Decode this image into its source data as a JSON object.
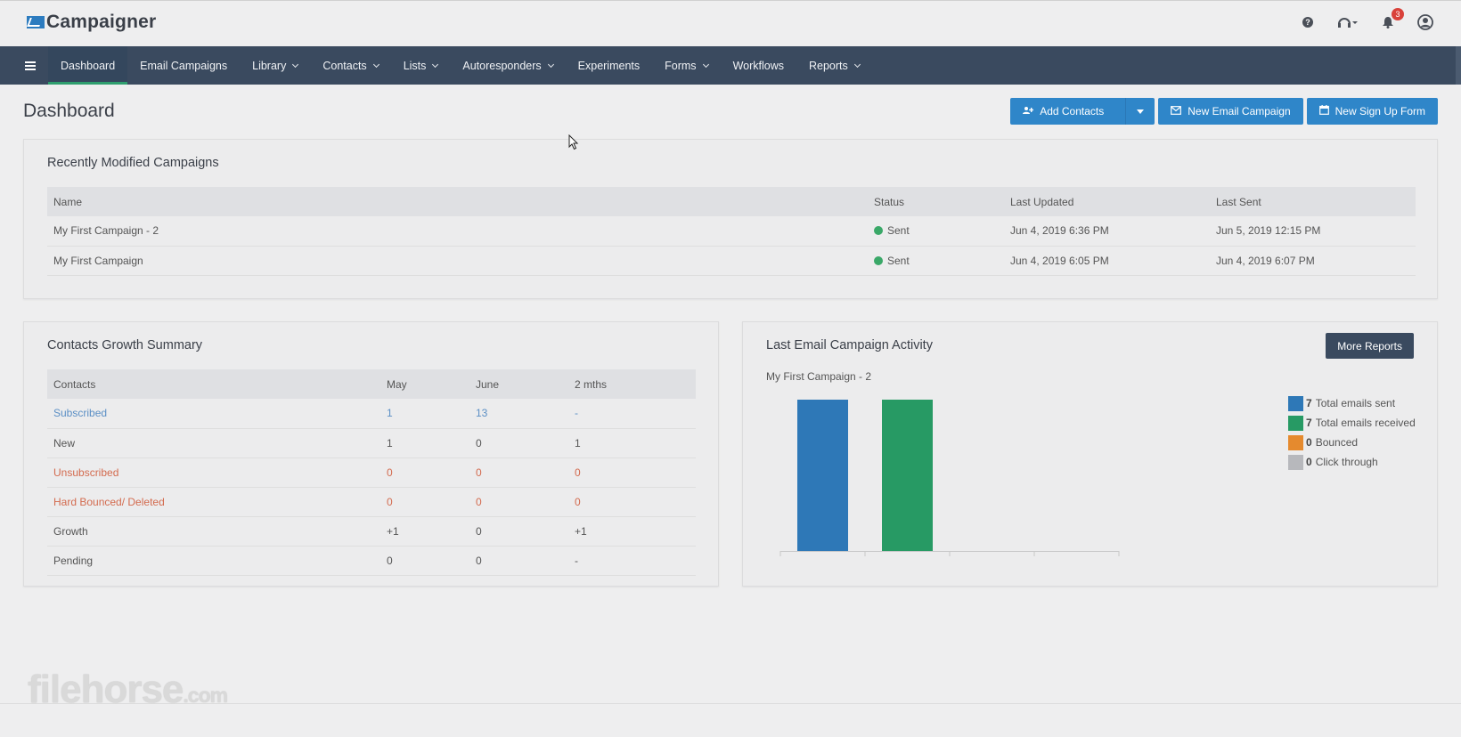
{
  "app": {
    "name": "Campaigner",
    "notification_count": "3"
  },
  "icons": {
    "help": "help-icon",
    "support": "headset-icon",
    "notifications": "bell-icon",
    "account": "user-circle-icon",
    "menu": "hamburger-icon"
  },
  "nav": {
    "items": [
      {
        "label": "Dashboard",
        "dropdown": false,
        "active": true
      },
      {
        "label": "Email Campaigns",
        "dropdown": false
      },
      {
        "label": "Library",
        "dropdown": true
      },
      {
        "label": "Contacts",
        "dropdown": true
      },
      {
        "label": "Lists",
        "dropdown": true
      },
      {
        "label": "Autoresponders",
        "dropdown": true
      },
      {
        "label": "Experiments",
        "dropdown": false
      },
      {
        "label": "Forms",
        "dropdown": true
      },
      {
        "label": "Workflows",
        "dropdown": false
      },
      {
        "label": "Reports",
        "dropdown": true
      }
    ]
  },
  "page": {
    "title": "Dashboard"
  },
  "actions": {
    "add_contacts": "Add Contacts",
    "new_email_campaign": "New Email Campaign",
    "new_sign_up_form": "New Sign Up Form"
  },
  "recent": {
    "title": "Recently Modified Campaigns",
    "headers": [
      "Name",
      "Status",
      "Last Updated",
      "Last Sent"
    ],
    "rows": [
      {
        "name": "My First Campaign - 2",
        "status": "Sent",
        "updated": "Jun 4, 2019 6:36 PM",
        "sent": "Jun 5, 2019 12:15 PM"
      },
      {
        "name": "My First Campaign",
        "status": "Sent",
        "updated": "Jun 4, 2019 6:05 PM",
        "sent": "Jun 4, 2019 6:07 PM"
      }
    ]
  },
  "growth": {
    "title": "Contacts Growth Summary",
    "headers": [
      "Contacts",
      "May",
      "June",
      "2 mths"
    ],
    "rows": [
      {
        "label": "Subscribed",
        "may": "1",
        "june": "13",
        "two": "-",
        "style": "blue"
      },
      {
        "label": "New",
        "may": "1",
        "june": "0",
        "two": "1",
        "style": ""
      },
      {
        "label": "Unsubscribed",
        "may": "0",
        "june": "0",
        "two": "0",
        "style": "red"
      },
      {
        "label": "Hard Bounced/ Deleted",
        "may": "0",
        "june": "0",
        "two": "0",
        "style": "red"
      },
      {
        "label": "Growth",
        "may": "+1",
        "june": "0",
        "two": "+1",
        "style": ""
      },
      {
        "label": "Pending",
        "may": "0",
        "june": "0",
        "two": "-",
        "style": ""
      }
    ]
  },
  "activity": {
    "title": "Last Email Campaign Activity",
    "more_reports": "More Reports",
    "campaign": "My First Campaign - 2"
  },
  "chart_data": {
    "type": "bar",
    "categories": [
      "Total emails sent",
      "Total emails received",
      "Bounced",
      "Click through"
    ],
    "values": [
      7,
      7,
      0,
      0
    ],
    "colors": [
      "#2e78b7",
      "#279a64",
      "#e58a2e",
      "#b7b8bc"
    ],
    "legend_position": "right",
    "ylim": [
      0,
      7
    ]
  },
  "watermark": {
    "main": "filehorse",
    "suffix": ".com"
  }
}
